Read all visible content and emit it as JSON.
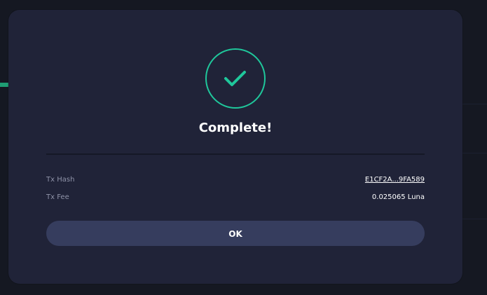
{
  "modal": {
    "title": "Complete!",
    "details": [
      {
        "label": "Tx Hash",
        "value": "E1CF2A...9FA589"
      },
      {
        "label": "Tx Fee",
        "value": "0.025065 Luna"
      }
    ],
    "ok_label": "OK"
  },
  "icons": {
    "status": "check-circle-icon"
  },
  "colors": {
    "accent": "#1fc79b",
    "modal_bg": "#202338",
    "button_bg": "#363d5e",
    "backdrop": "#151822"
  }
}
